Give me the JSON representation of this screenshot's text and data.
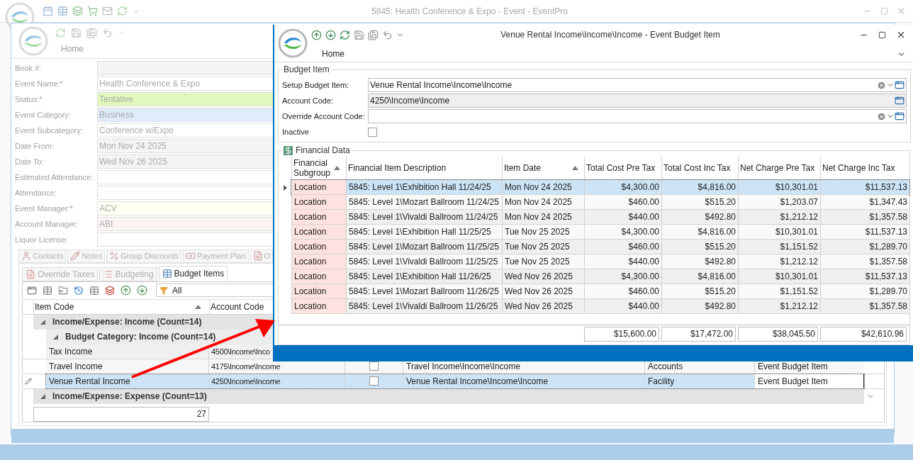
{
  "main_window": {
    "title": "5845: Health Conference & Expo - Event - EventPro"
  },
  "event_window": {
    "ribbon_tab": "Home",
    "fields": [
      {
        "label": "Book #:",
        "color": "#f4f4f4"
      },
      {
        "label": "Event Name:*",
        "value": "Health Conference & Expo"
      },
      {
        "label": "Status:*",
        "value": "Tentative",
        "color": "#e1f8bd"
      },
      {
        "label": "Event Category:",
        "value": "Business",
        "color": "#e0ecfa"
      },
      {
        "label": "Event Subcategory:",
        "value": "Conference w/Expo"
      },
      {
        "label": "Date From:",
        "value": "Mon Nov 24 2025",
        "color": "#f4f4f4"
      },
      {
        "label": "Date To:",
        "value": "Wed Nov 26 2025",
        "color": "#f4f4f4"
      },
      {
        "label": "Estimated Attendance:"
      },
      {
        "label": "Attendance:"
      },
      {
        "label": "Event Manager:*",
        "value": "ACV",
        "color": "#fffef2"
      },
      {
        "label": "Account Manager:",
        "value": "ABI",
        "color": "#fdf3f3"
      },
      {
        "label": "Liquor License:"
      }
    ],
    "tabs": [
      {
        "label": "Contacts",
        "kind": "person",
        "selected": false
      },
      {
        "label": "Notes",
        "kind": "note",
        "selected": false
      },
      {
        "label": "Group Discounts",
        "kind": "percent",
        "selected": false
      },
      {
        "label": "Payment Plan",
        "kind": "money",
        "selected": false
      },
      {
        "label": "O",
        "kind": "doc",
        "selected": false
      }
    ],
    "subtabs": [
      {
        "label": "Override Taxes",
        "kind": "doc",
        "selected": false
      },
      {
        "label": "Budgeting",
        "kind": "list",
        "selected": false
      },
      {
        "label": "Budget Items",
        "kind": "table",
        "selected": true
      }
    ],
    "filter": "All",
    "grid": {
      "columns": [
        {
          "label": "Item Code",
          "sorted": true
        },
        {
          "label": "Account Code"
        }
      ],
      "groups": [
        {
          "label": "Income/Expense: Income (Count=14)",
          "children": [
            {
              "label": "Budget Category: Income (Count=14)",
              "rows": [
                {
                  "item_code": "Tax Income",
                  "account_code": "4500\\Income\\Inco",
                  "selected": false
                },
                {
                  "item_code": "Travel Income",
                  "account_code": "4175\\Income\\Income",
                  "inactive": false,
                  "description": "Travel Income\\Income\\Income",
                  "category": "Accounts",
                  "type": "Event Budget Item",
                  "selected": false
                },
                {
                  "item_code": "Venue Rental Income",
                  "account_code": "4250\\Income\\Income",
                  "inactive": false,
                  "description": "Venue Rental Income\\Income\\Income",
                  "category": "Facility",
                  "type": "Event Budget Item",
                  "selected": true
                }
              ]
            }
          ]
        },
        {
          "label": "Income/Expense: Expense (Count=13)"
        }
      ],
      "total": "27"
    }
  },
  "budget_item_window": {
    "title": "Venue Rental Income\\Income\\Income - Event Budget Item",
    "ribbon_tab": "Home",
    "group_title": "Budget Item",
    "fields": [
      {
        "label": "Setup Budget Item:",
        "value": "Venue Rental Income\\Income\\Income",
        "kind": "lookup"
      },
      {
        "label": "Account Code:",
        "value": "4250\\Income\\Income",
        "kind": "readonly"
      },
      {
        "label": "Override Account Code:",
        "kind": "lookup"
      },
      {
        "label": "Inactive",
        "kind": "checkbox",
        "checked": false
      }
    ],
    "financial_data": {
      "title": "Financial Data",
      "columns": [
        {
          "label": "Financial Subgroup",
          "sorted": true
        },
        {
          "label": "Financial Item Description",
          "sorted": false
        },
        {
          "label": "Item Date",
          "sorted": true
        },
        {
          "label": "Total Cost Pre Tax",
          "sorted": false
        },
        {
          "label": "Total Cost Inc Tax",
          "sorted": false
        },
        {
          "label": "Net Charge Pre Tax",
          "sorted": false
        },
        {
          "label": "Net Charge Inc Tax",
          "sorted": false
        }
      ],
      "rows": [
        {
          "cells": [
            "Location",
            "5845: Level 1\\Exhibition Hall 11/24/25",
            "Mon Nov 24 2025",
            "$4,300.00",
            "$4,816.00",
            "$10,301.01",
            "$11,537.13"
          ],
          "selected": true
        },
        {
          "cells": [
            "Location",
            "5845: Level 1\\Mozart Ballroom 11/24/25",
            "Mon Nov 24 2025",
            "$460.00",
            "$515.20",
            "$1,203.07",
            "$1,347.43"
          ],
          "selected": false
        },
        {
          "cells": [
            "Location",
            "5845: Level 1\\Vivaldi Ballroom 11/24/25",
            "Mon Nov 24 2025",
            "$440.00",
            "$492.80",
            "$1,212.12",
            "$1,357.58"
          ],
          "selected": false
        },
        {
          "cells": [
            "Location",
            "5845: Level 1\\Exhibition Hall 11/25/25",
            "Tue Nov 25 2025",
            "$4,300.00",
            "$4,816.00",
            "$10,301.01",
            "$11,537.13"
          ],
          "selected": false
        },
        {
          "cells": [
            "Location",
            "5845: Level 1\\Mozart Ballroom 11/25/25",
            "Tue Nov 25 2025",
            "$460.00",
            "$515.20",
            "$1,151.52",
            "$1,289.70"
          ],
          "selected": false
        },
        {
          "cells": [
            "Location",
            "5845: Level 1\\Vivaldi Ballroom 11/25/25",
            "Tue Nov 25 2025",
            "$440.00",
            "$492.80",
            "$1,212.12",
            "$1,357.58"
          ],
          "selected": false
        },
        {
          "cells": [
            "Location",
            "5845: Level 1\\Exhibition Hall 11/26/25",
            "Wed Nov 26 2025",
            "$4,300.00",
            "$4,816.00",
            "$10,301.01",
            "$11,537.13"
          ],
          "selected": false
        },
        {
          "cells": [
            "Location",
            "5845: Level 1\\Mozart Ballroom 11/26/25",
            "Wed Nov 26 2025",
            "$460.00",
            "$515.20",
            "$1,151.52",
            "$1,289.70"
          ],
          "selected": false
        },
        {
          "cells": [
            "Location",
            "5845: Level 1\\Vivaldi Ballroom 11/26/25",
            "Wed Nov 26 2025",
            "$440.00",
            "$492.80",
            "$1,212.12",
            "$1,357.58"
          ],
          "selected": false
        }
      ],
      "totals": [
        "$15,600.00",
        "$17,472.00",
        "$38,045.50",
        "$42,610.96"
      ]
    }
  }
}
